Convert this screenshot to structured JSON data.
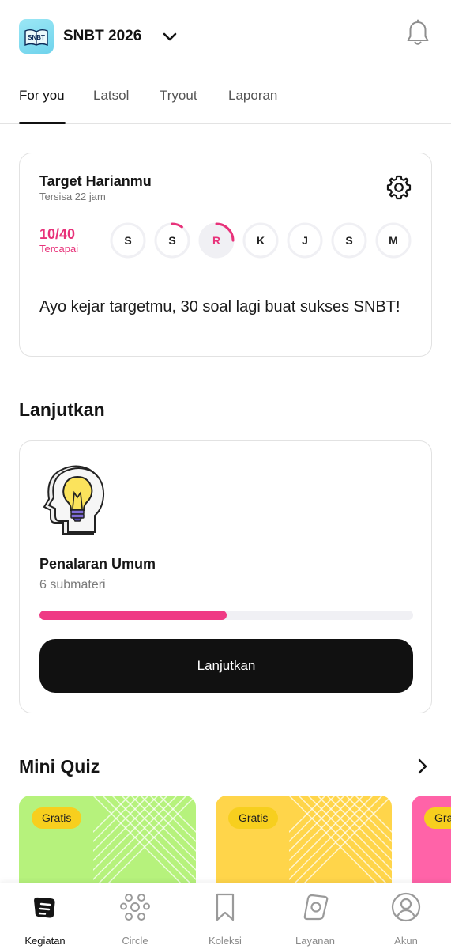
{
  "header": {
    "logo_text": "SNBT",
    "app_title": "SNBT 2026",
    "icons": {
      "dropdown": "chevron-down-icon",
      "notifications": "bell-icon"
    }
  },
  "tabs": [
    {
      "label": "For you",
      "active": true
    },
    {
      "label": "Latsol",
      "active": false
    },
    {
      "label": "Tryout",
      "active": false
    },
    {
      "label": "Laporan",
      "active": false
    }
  ],
  "target": {
    "title": "Target Harianmu",
    "subtitle": "Tersisa 22 jam",
    "progress_count": "10/40",
    "progress_label": "Tercapai",
    "days": [
      {
        "letter": "S",
        "progress": 0
      },
      {
        "letter": "S",
        "progress": 0.1
      },
      {
        "letter": "R",
        "progress": 0.25,
        "today": true
      },
      {
        "letter": "K",
        "progress": 0
      },
      {
        "letter": "J",
        "progress": 0
      },
      {
        "letter": "S",
        "progress": 0
      },
      {
        "letter": "M",
        "progress": 0
      }
    ],
    "message": "Ayo kejar targetmu, 30 soal lagi buat sukses SNBT!",
    "icon": "gear-icon"
  },
  "continue_section": {
    "title": "Lanjutkan",
    "course_title": "Penalaran Umum",
    "course_sub": "6 submateri",
    "progress": 0.5,
    "button_label": "Lanjutkan",
    "icon": "lightbulb-head-icon"
  },
  "mini_quiz": {
    "title": "Mini Quiz",
    "cards": [
      {
        "badge": "Gratis",
        "color": "#b6f27c"
      },
      {
        "badge": "Gratis",
        "color": "#ffd54a"
      },
      {
        "badge": "Gra",
        "color": "#ff63a8"
      }
    ]
  },
  "bottom_nav": [
    {
      "label": "Kegiatan",
      "icon": "activity-icon",
      "active": true
    },
    {
      "label": "Circle",
      "icon": "community-icon",
      "active": false
    },
    {
      "label": "Koleksi",
      "icon": "bookmark-icon",
      "active": false
    },
    {
      "label": "Layanan",
      "icon": "services-icon",
      "active": false
    },
    {
      "label": "Akun",
      "icon": "account-icon",
      "active": false
    }
  ],
  "colors": {
    "accent": "#e8327a",
    "button": "#111111"
  }
}
